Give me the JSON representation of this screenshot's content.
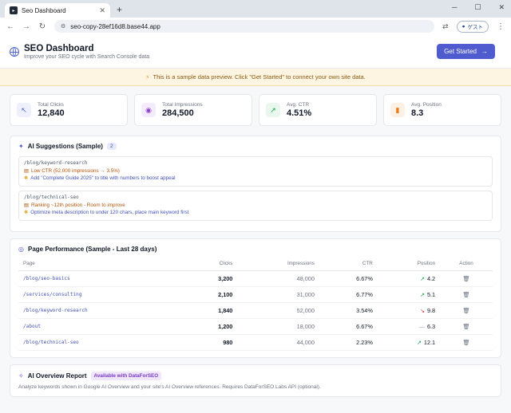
{
  "browser": {
    "tab_title": "Seo Dashboard",
    "url": "seo-copy-28ef16d8.base44.app",
    "guest_label": "ゲスト"
  },
  "header": {
    "title": "SEO Dashboard",
    "subtitle": "Improve your SEO cycle with Search Console data",
    "cta_label": "Get Started"
  },
  "banner": {
    "text": "This is a sample data preview. Click \"Get Started\" to connect your own site data."
  },
  "stats": [
    {
      "label": "Total Clicks",
      "value": "12,840",
      "icon": "cursor-click-icon",
      "color": "#4f5ccf",
      "bg": "#eef0fb",
      "glyph": "↖"
    },
    {
      "label": "Total Impressions",
      "value": "284,500",
      "icon": "eye-icon",
      "color": "#8b3fd1",
      "bg": "#f4ebfc",
      "glyph": "◉"
    },
    {
      "label": "Avg. CTR",
      "value": "4.51%",
      "icon": "trending-up-icon",
      "color": "#16a34a",
      "bg": "#eaf7ef",
      "glyph": "↗"
    },
    {
      "label": "Avg. Position",
      "value": "8.3",
      "icon": "bar-chart-icon",
      "color": "#ea7a1a",
      "bg": "#fdf1e6",
      "glyph": "▮"
    }
  ],
  "suggestions": {
    "title": "AI Suggestions (Sample)",
    "count": "2",
    "items": [
      {
        "path": "/blog/keyword-research",
        "issue": "Low CTR (52,000 impressions → 3.5%)",
        "tip": "Add \"Complete Guide 2025\" to title with numbers to boost appeal"
      },
      {
        "path": "/blog/technical-seo",
        "issue": "Ranking ~12th position - Room to improve",
        "tip": "Optimize meta description to under 120 chars, place main keyword first"
      }
    ]
  },
  "performance": {
    "title": "Page Performance (Sample - Last 28 days)",
    "columns": [
      "Page",
      "Clicks",
      "Impressions",
      "CTR",
      "Position",
      "Action"
    ],
    "rows": [
      {
        "page": "/blog/seo-basics",
        "clicks": "3,200",
        "impressions": "48,000",
        "ctr": "6.67%",
        "position": "4.2",
        "trend": "up"
      },
      {
        "page": "/services/consulting",
        "clicks": "2,100",
        "impressions": "31,000",
        "ctr": "6.77%",
        "position": "5.1",
        "trend": "up"
      },
      {
        "page": "/blog/keyword-research",
        "clicks": "1,840",
        "impressions": "52,000",
        "ctr": "3.54%",
        "position": "9.8",
        "trend": "down"
      },
      {
        "page": "/about",
        "clicks": "1,200",
        "impressions": "18,000",
        "ctr": "6.67%",
        "position": "6.3",
        "trend": "flat"
      },
      {
        "page": "/blog/technical-seo",
        "clicks": "980",
        "impressions": "44,000",
        "ctr": "2.23%",
        "position": "12.1",
        "trend": "up"
      }
    ]
  },
  "ai_overview": {
    "title": "AI Overview Report",
    "badge": "Available with DataForSEO",
    "description": "Analyze keywords shown in Google AI Overview and your site's AI Overview references. Requires DataForSEO Labs API (optional)."
  }
}
